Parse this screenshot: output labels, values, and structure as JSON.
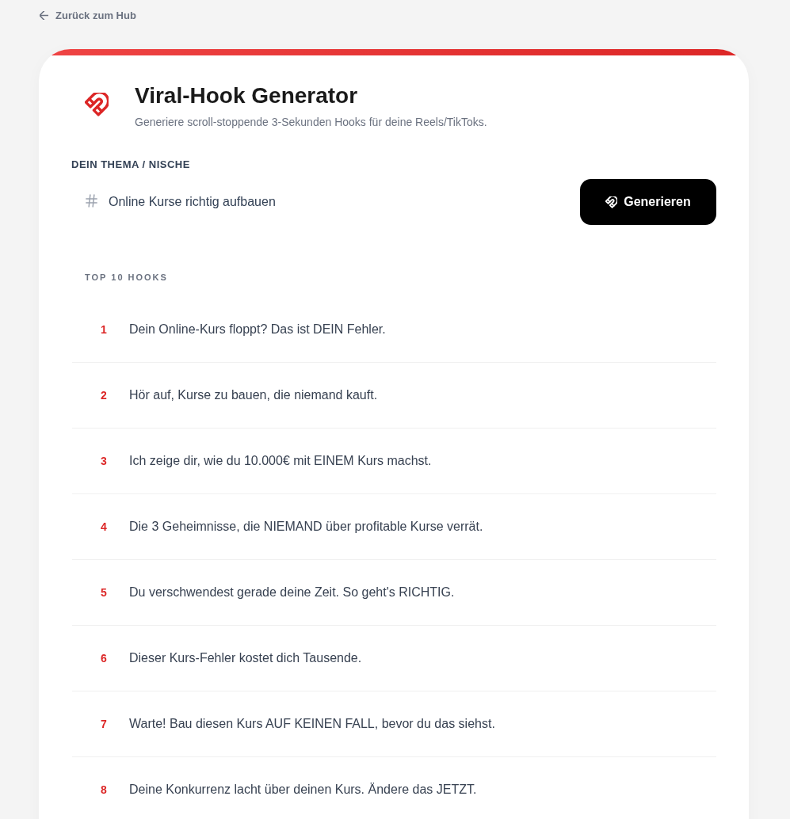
{
  "back_link": {
    "label": "Zurück zum Hub"
  },
  "header": {
    "title": "Viral-Hook Generator",
    "subtitle": "Generiere scroll-stoppende 3-Sekunden Hooks für deine Reels/TikToks."
  },
  "topic": {
    "label": "DEIN THEMA / NISCHE",
    "value": "Online Kurse richtig aufbauen"
  },
  "generate_button": {
    "label": "Generieren"
  },
  "hooks": {
    "heading": "TOP 10 HOOKS",
    "items": [
      {
        "number": "1",
        "text": "Dein Online-Kurs floppt? Das ist DEIN Fehler."
      },
      {
        "number": "2",
        "text": "Hör auf, Kurse zu bauen, die niemand kauft."
      },
      {
        "number": "3",
        "text": "Ich zeige dir, wie du 10.000€ mit EINEM Kurs machst."
      },
      {
        "number": "4",
        "text": "Die 3 Geheimnisse, die NIEMAND über profitable Kurse verrät."
      },
      {
        "number": "5",
        "text": "Du verschwendest gerade deine Zeit. So geht's RICHTIG."
      },
      {
        "number": "6",
        "text": "Dieser Kurs-Fehler kostet dich Tausende."
      },
      {
        "number": "7",
        "text": "Warte! Bau diesen Kurs AUF KEINEN FALL, bevor du das siehst."
      },
      {
        "number": "8",
        "text": "Deine Konkurrenz lacht über deinen Kurs. Ändere das JETZT."
      }
    ]
  }
}
